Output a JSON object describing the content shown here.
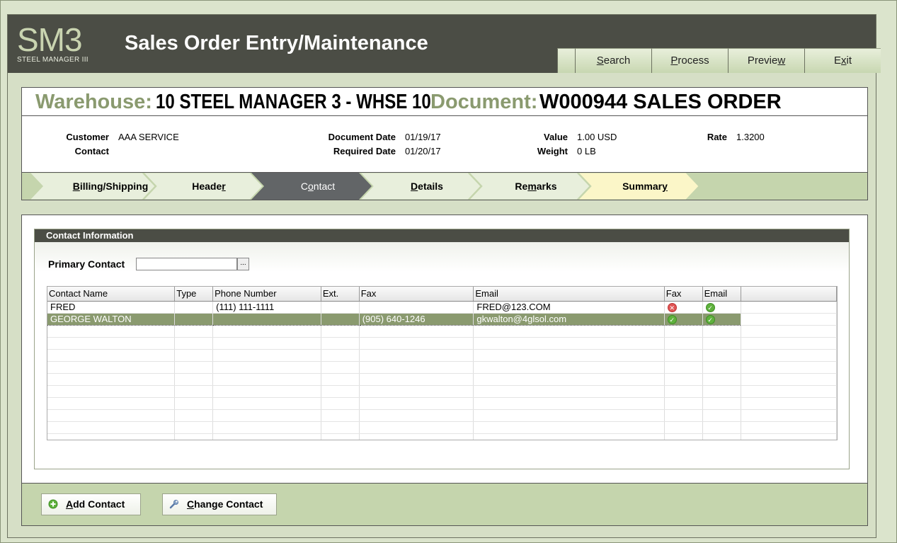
{
  "app": {
    "logo": "SM3",
    "logo_subtitle": "STEEL MANAGER III",
    "title": "Sales Order Entry/Maintenance"
  },
  "toolbar": {
    "buttons": [
      {
        "pre": "",
        "key": "S",
        "post": "earch"
      },
      {
        "pre": "",
        "key": "P",
        "post": "rocess"
      },
      {
        "pre": "Previe",
        "key": "w",
        "post": ""
      },
      {
        "pre": "E",
        "key": "x",
        "post": "it"
      }
    ]
  },
  "document": {
    "warehouse_label": "Warehouse:",
    "warehouse_value": "10 STEEL MANAGER 3 - WHSE 10",
    "document_label": "Document:",
    "document_value": "W000944 SALES ORDER",
    "fields": {
      "customer_label": "Customer",
      "customer_value": "AAA SERVICE",
      "contact_label": "Contact",
      "contact_value": "",
      "document_date_label": "Document Date",
      "document_date_value": "01/19/17",
      "required_date_label": "Required Date",
      "required_date_value": "01/20/17",
      "value_label": "Value",
      "value_value": "1.00 USD",
      "weight_label": "Weight",
      "weight_value": "0 LB",
      "rate_label": "Rate",
      "rate_value": "1.3200"
    }
  },
  "tabs": [
    {
      "pre": "",
      "key": "B",
      "post": "illing/Shipping",
      "state": "normal"
    },
    {
      "pre": "Heade",
      "key": "r",
      "post": "",
      "state": "normal"
    },
    {
      "pre": "C",
      "key": "o",
      "post": "ntact",
      "state": "active"
    },
    {
      "pre": "",
      "key": "D",
      "post": "etails",
      "state": "normal"
    },
    {
      "pre": "Re",
      "key": "m",
      "post": "arks",
      "state": "normal"
    },
    {
      "pre": "Summar",
      "key": "y",
      "post": "",
      "state": "summary"
    }
  ],
  "contact_section": {
    "title": "Contact Information",
    "primary_contact_label": "Primary Contact",
    "primary_contact_value": "",
    "browse_label": "...",
    "columns": [
      "Contact Name",
      "Type",
      "Phone Number",
      "Ext.",
      "Fax",
      "Email",
      "Fax",
      "Email"
    ],
    "rows": [
      {
        "name": "FRED",
        "type": "",
        "phone": "(111) 111-1111",
        "ext": "",
        "fax": "",
        "email": "FRED@123.COM",
        "fax_flag": "no",
        "email_flag": "yes",
        "selected": false
      },
      {
        "name": "GEORGE WALTON",
        "type": "",
        "phone": "",
        "ext": "",
        "fax": "(905) 640-1246",
        "email": "gkwalton@4glsol.com",
        "fax_flag": "yes",
        "email_flag": "yes",
        "selected": true
      }
    ]
  },
  "footer": {
    "add_contact": {
      "pre": "",
      "key": "A",
      "post": "dd Contact"
    },
    "change_contact": {
      "pre": "",
      "key": "C",
      "post": "hange Contact"
    }
  },
  "colors": {
    "accent_green": "#8a9a6f",
    "dark_bar": "#4b4d45",
    "tab_bg": "#c5d5ad",
    "summary_tab": "#fbf6c8"
  }
}
